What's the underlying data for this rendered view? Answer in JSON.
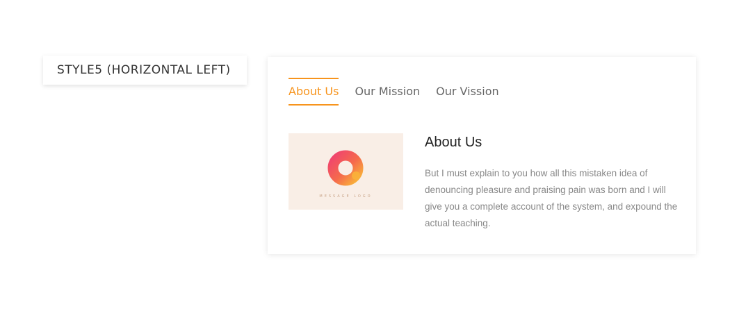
{
  "style_label": "STYLE5 (HORIZONTAL LEFT)",
  "tabs": [
    {
      "label": "About Us",
      "active": true
    },
    {
      "label": "Our Mission",
      "active": false
    },
    {
      "label": "Our Vission",
      "active": false
    }
  ],
  "content": {
    "title": "About Us",
    "text": "But I must explain to you how all this mistaken idea of denouncing pleasure and praising pain was born and I will give you a complete account of the system, and expound the actual teaching.",
    "image": {
      "caption": "MESSAGE LOGO",
      "icon": "o-ring-logo-icon"
    }
  },
  "colors": {
    "accent": "#f7941d",
    "thumb_bg": "#f9eee6"
  }
}
